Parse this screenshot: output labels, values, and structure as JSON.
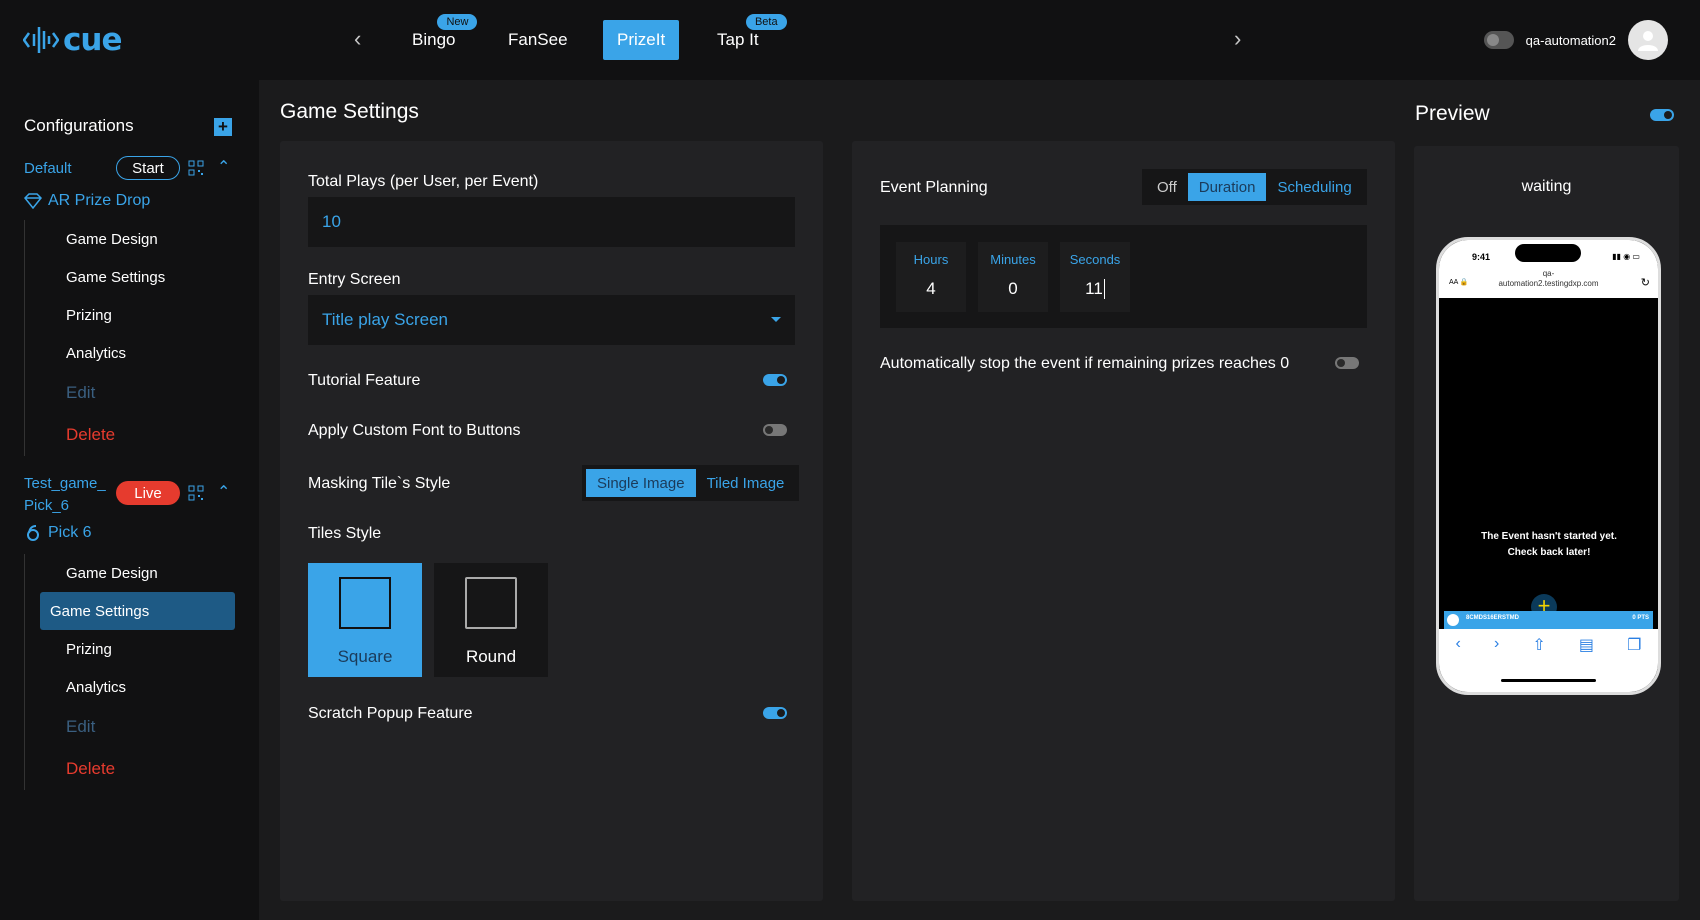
{
  "app": {
    "logo": "cue"
  },
  "topnav": {
    "tabs": [
      {
        "label": "Bingo",
        "badge": "New"
      },
      {
        "label": "FanSee",
        "badge": ""
      },
      {
        "label": "PrizeIt",
        "badge": ""
      },
      {
        "label": "Tap It",
        "badge": "Beta"
      }
    ],
    "active_tab": "PrizeIt",
    "username": "qa-automation2"
  },
  "sidebar": {
    "title": "Configurations",
    "configs": [
      {
        "name": "Default",
        "status": "Start",
        "game_type": "AR Prize Drop",
        "items": [
          "Game Design",
          "Game Settings",
          "Prizing",
          "Analytics",
          "Edit",
          "Delete"
        ]
      },
      {
        "name_line1": "Test_game_",
        "name_line2": "Pick_6",
        "status": "Live",
        "game_type": "Pick 6",
        "items": [
          "Game Design",
          "Game Settings",
          "Prizing",
          "Analytics",
          "Edit",
          "Delete"
        ],
        "active_item": "Game Settings"
      }
    ]
  },
  "main": {
    "heading": "Game Settings",
    "total_plays_label": "Total Plays (per User, per Event)",
    "total_plays_value": "10",
    "entry_screen_label": "Entry Screen",
    "entry_screen_value": "Title play Screen",
    "tutorial_label": "Tutorial Feature",
    "tutorial_on": true,
    "custom_font_label": "Apply Custom Font to Buttons",
    "custom_font_on": false,
    "masking_label": "Masking Tile`s Style",
    "masking_options": [
      "Single Image",
      "Tiled Image"
    ],
    "masking_selected": "Single Image",
    "tiles_label": "Tiles Style",
    "tile_options": [
      "Square",
      "Round"
    ],
    "tile_selected": "Square",
    "scratch_label": "Scratch Popup Feature",
    "scratch_on": true
  },
  "event": {
    "label": "Event Planning",
    "modes": [
      "Off",
      "Duration",
      "Scheduling"
    ],
    "mode_selected": "Duration",
    "hours_label": "Hours",
    "hours": "4",
    "minutes_label": "Minutes",
    "minutes": "0",
    "seconds_label": "Seconds",
    "seconds": "11",
    "autostop_label": "Automatically stop the event if remaining prizes reaches 0",
    "autostop_on": false
  },
  "preview": {
    "title": "Preview",
    "enabled": true,
    "state": "waiting",
    "phone_time": "9:41",
    "url_line1": "qa-",
    "url_line2": "automation2.testingdxp.com",
    "message": "The Event hasn't started yet. Check back later!",
    "footer_left": "8CMDS16ERSTMD",
    "footer_right": "0 PTS"
  },
  "colors": {
    "accent": "#3aa4e8",
    "danger": "#e63b2e",
    "bg": "#1b1b1c",
    "panel": "#222224"
  }
}
